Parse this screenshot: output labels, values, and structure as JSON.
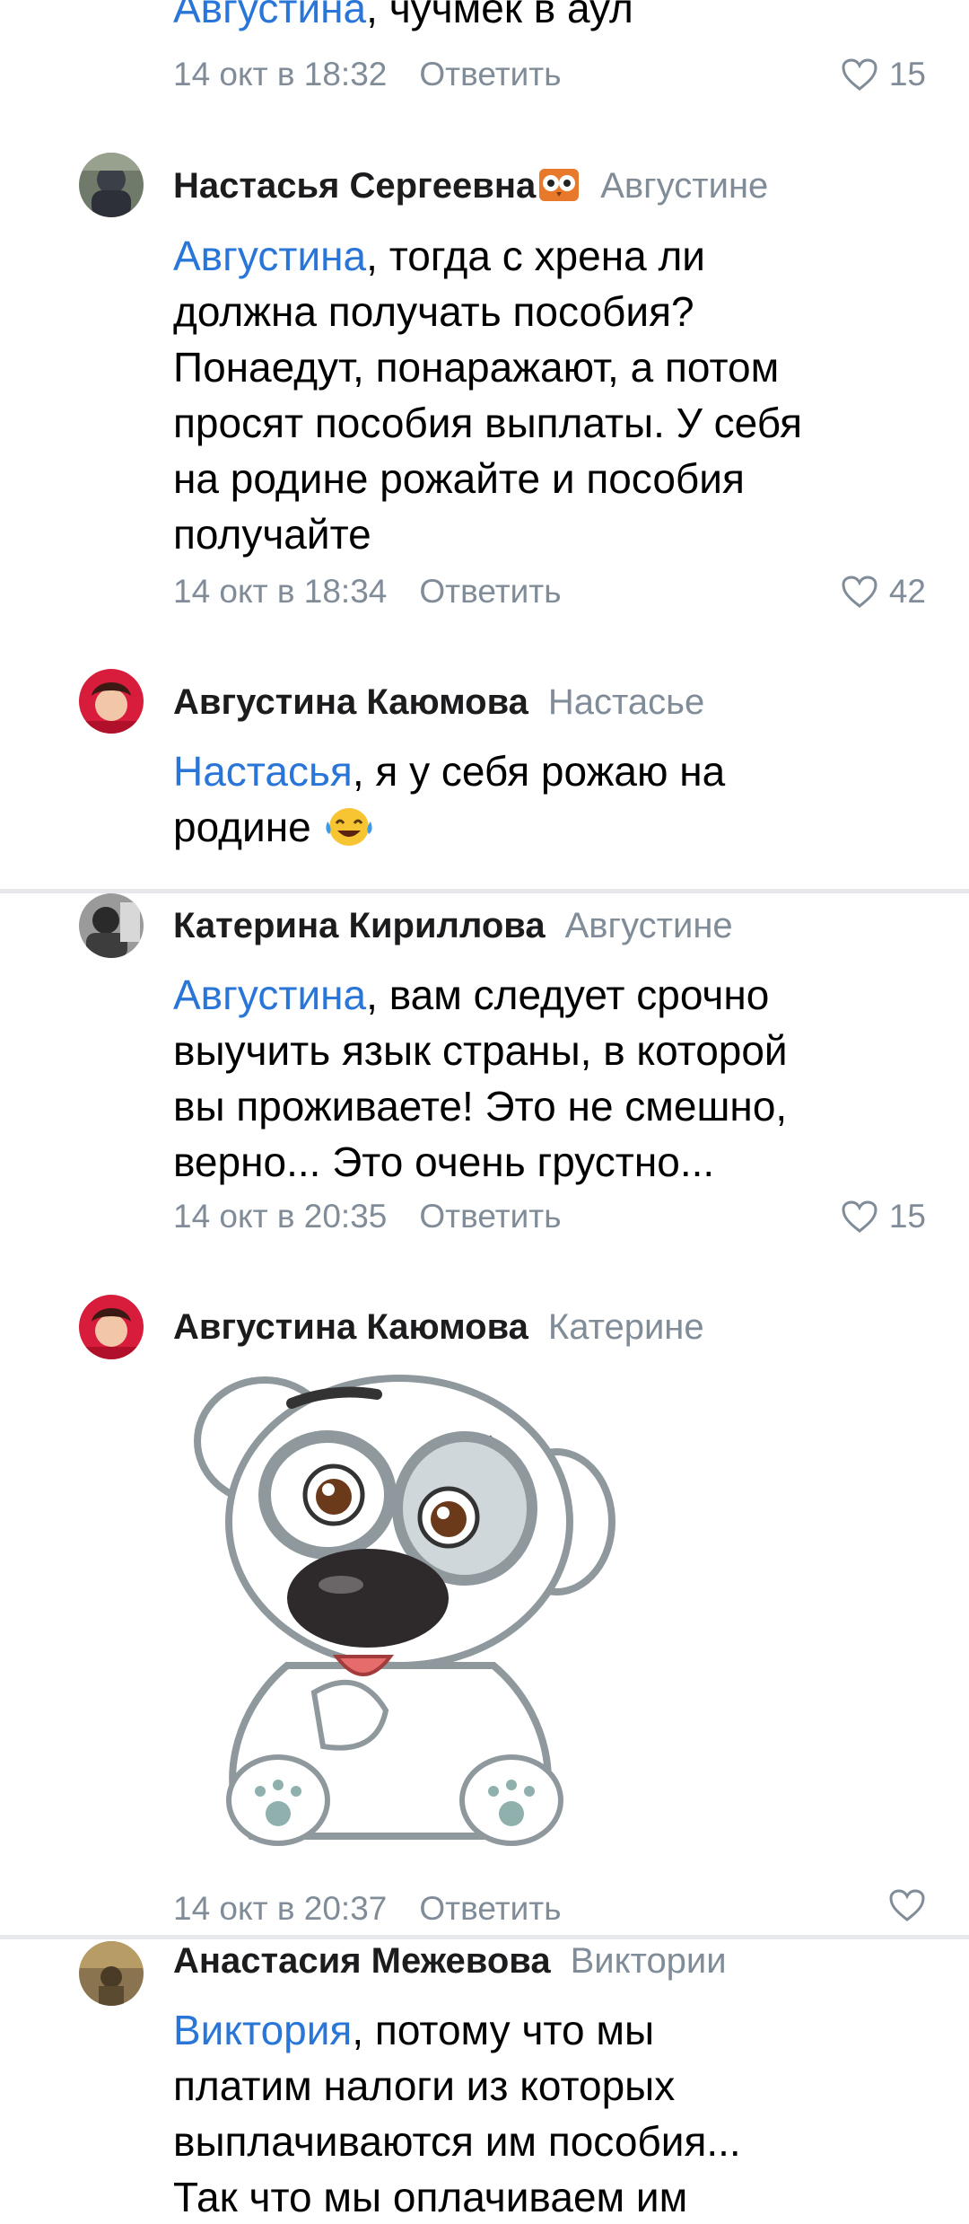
{
  "colors": {
    "mention": "#2a76d8",
    "secondary": "#818c99",
    "divider": "#e6e8ec"
  },
  "comments": [
    {
      "mention": "Августина",
      "text": ", чучмек в аул",
      "date": "14 окт в 18:32",
      "reply_label": "Ответить",
      "likes": "15"
    },
    {
      "author": "Настасья Сергеевна",
      "author_icon": "owl-emoji-icon",
      "reply_to": "Августине",
      "mention": "Августина",
      "lines": [
        ", тогда с хрена ли",
        "должна получать пособия?",
        "Понаедут, понаражают, а потом",
        "просят пособия выплаты. У себя",
        "на родине рожайте и пособия",
        "получайте"
      ],
      "date": "14 окт в 18:34",
      "reply_label": "Ответить",
      "likes": "42"
    },
    {
      "author": "Августина Каюмова",
      "reply_to": "Настасье",
      "mention": "Настасья",
      "lines": [
        ", я у себя рожаю на",
        "родине"
      ],
      "emoji": "laughing-tears-emoji-icon"
    },
    {
      "author": "Катерина Кириллова",
      "reply_to": "Августине",
      "mention": "Августина",
      "lines": [
        ", вам следует срочно",
        "выучить язык страны, в которой",
        "вы проживаете! Это не смешно,",
        "верно... Это очень грустно..."
      ],
      "date": "14 окт в 20:35",
      "reply_label": "Ответить",
      "likes": "15"
    },
    {
      "author": "Августина Каюмова",
      "reply_to": "Катерине",
      "sticker": "white-puppy-sticker-icon",
      "date": "14 окт в 20:37",
      "reply_label": "Ответить"
    },
    {
      "author": "Анастасия Межевова",
      "reply_to": "Виктории",
      "mention": "Виктория",
      "lines": [
        ", потому что мы",
        "платим налоги из которых",
        "выплачиваются им пособия...",
        "Так что мы оплачиваем им"
      ]
    }
  ]
}
